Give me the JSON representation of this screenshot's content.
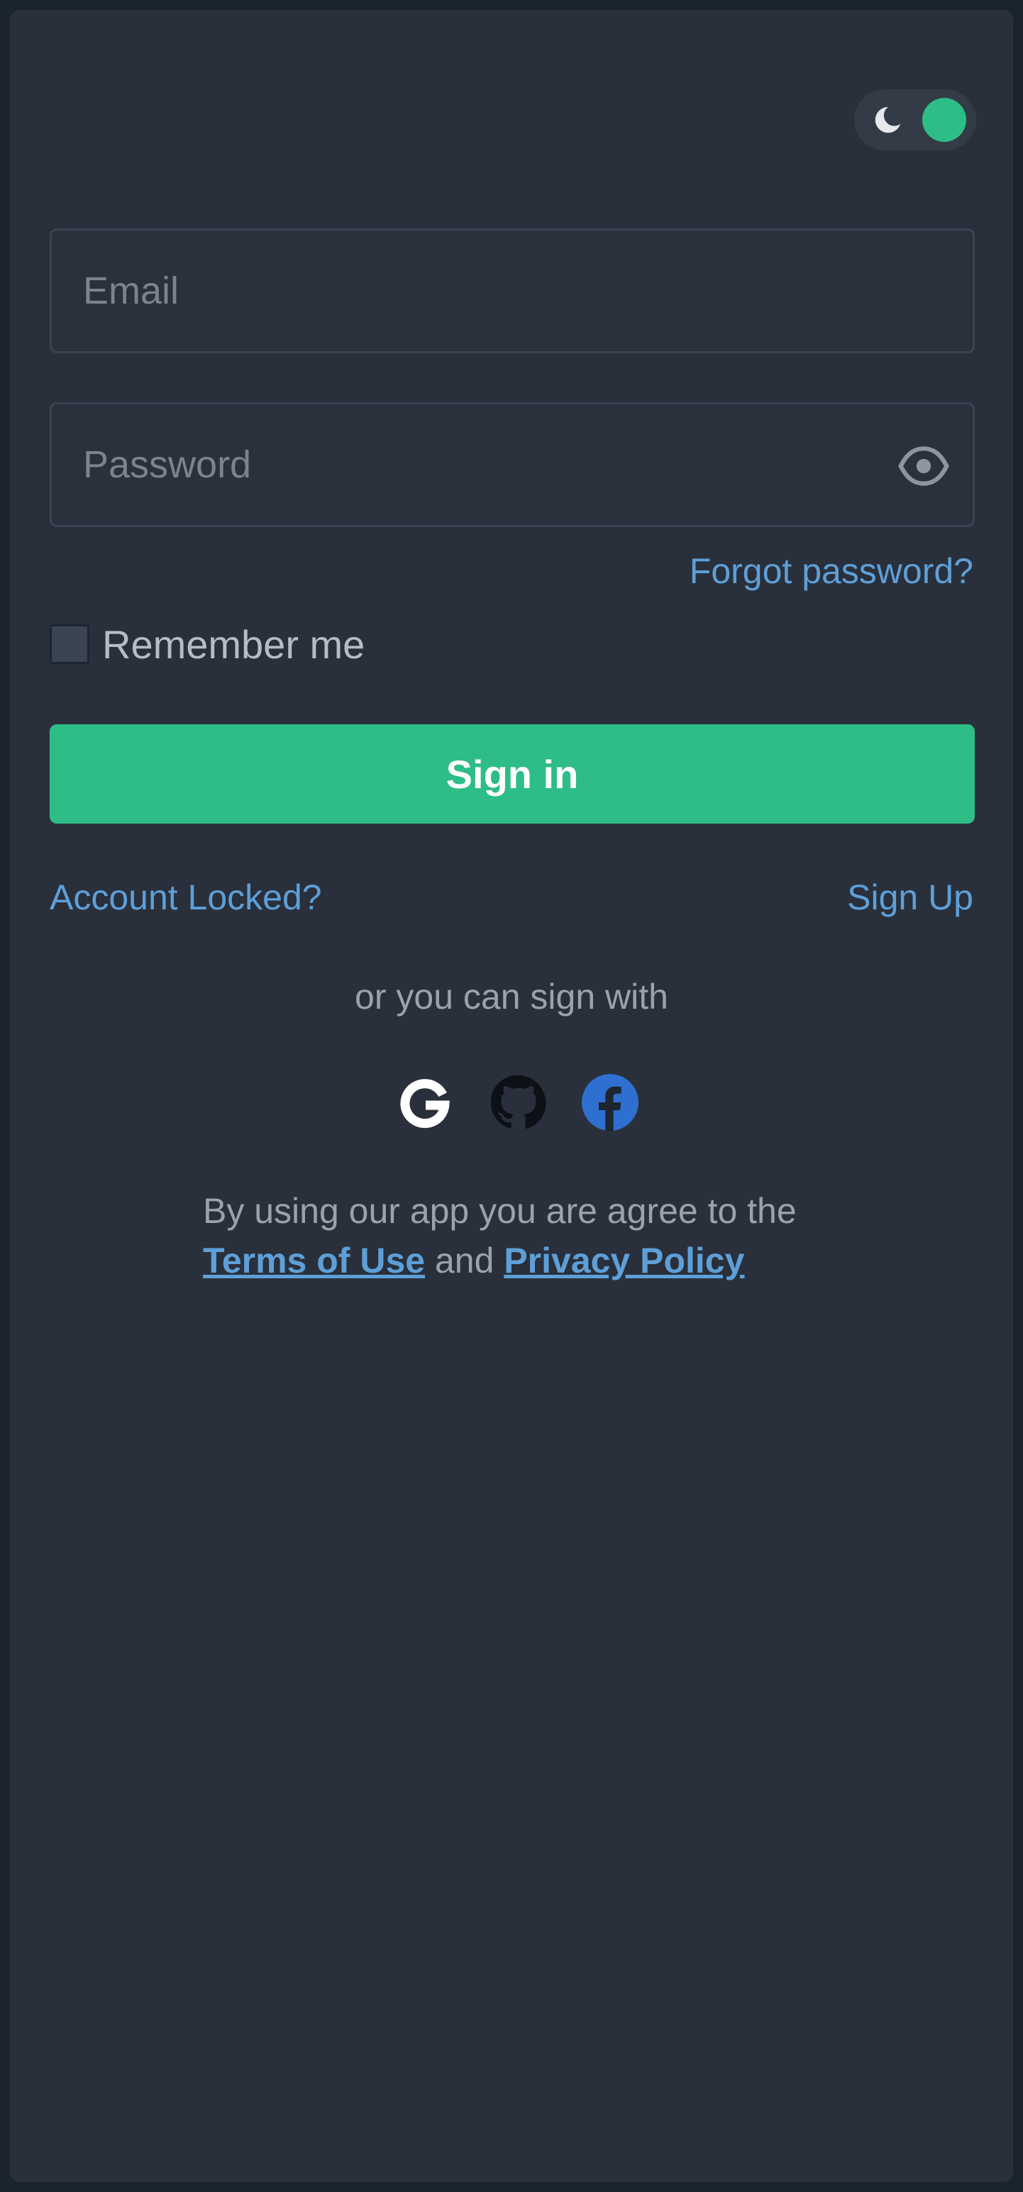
{
  "theme_toggle": {
    "icon": "moon-icon",
    "state": "dark"
  },
  "form": {
    "email": {
      "placeholder": "Email",
      "value": ""
    },
    "password": {
      "placeholder": "Password",
      "value": "",
      "toggle_icon": "eye-icon"
    },
    "forgot_password": "Forgot password?",
    "remember_me": {
      "label": "Remember me",
      "checked": false
    },
    "submit_label": "Sign in"
  },
  "links": {
    "account_locked": "Account Locked?",
    "sign_up": "Sign Up"
  },
  "social": {
    "heading": "or you can sign with",
    "providers": [
      "google-icon",
      "github-icon",
      "facebook-icon"
    ]
  },
  "legal": {
    "prefix": "By using our app you are agree to the",
    "terms": "Terms of Use",
    "connector": "and",
    "privacy": "Privacy Policy"
  },
  "colors": {
    "background": "#29303b",
    "accent": "#2ebd86",
    "link": "#5e9fd8",
    "facebook": "#2f6fcf"
  }
}
